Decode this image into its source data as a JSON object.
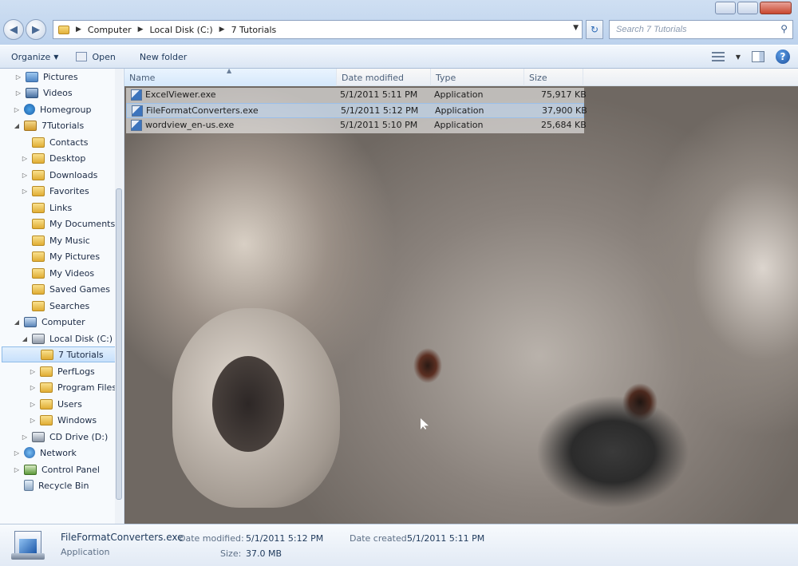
{
  "address": {
    "crumbs": [
      "Computer",
      "Local Disk (C:)",
      "7 Tutorials"
    ]
  },
  "search": {
    "placeholder": "Search 7 Tutorials"
  },
  "toolbar": {
    "organize": "Organize",
    "open": "Open",
    "new_folder": "New folder"
  },
  "navpane": {
    "items": [
      {
        "label": "Pictures"
      },
      {
        "label": "Videos"
      },
      {
        "label": "Homegroup"
      },
      {
        "label": "7Tutorials"
      },
      {
        "label": "Contacts"
      },
      {
        "label": "Desktop"
      },
      {
        "label": "Downloads"
      },
      {
        "label": "Favorites"
      },
      {
        "label": "Links"
      },
      {
        "label": "My Documents"
      },
      {
        "label": "My Music"
      },
      {
        "label": "My Pictures"
      },
      {
        "label": "My Videos"
      },
      {
        "label": "Saved Games"
      },
      {
        "label": "Searches"
      },
      {
        "label": "Computer"
      },
      {
        "label": "Local Disk (C:)"
      },
      {
        "label": "7 Tutorials"
      },
      {
        "label": "PerfLogs"
      },
      {
        "label": "Program Files"
      },
      {
        "label": "Users"
      },
      {
        "label": "Windows"
      },
      {
        "label": "CD Drive (D:)"
      },
      {
        "label": "Network"
      },
      {
        "label": "Control Panel"
      },
      {
        "label": "Recycle Bin"
      }
    ]
  },
  "columns": {
    "name": "Name",
    "date": "Date modified",
    "type": "Type",
    "size": "Size"
  },
  "files": [
    {
      "name": "ExcelViewer.exe",
      "date": "5/1/2011 5:11 PM",
      "type": "Application",
      "size": "75,917 KB"
    },
    {
      "name": "FileFormatConverters.exe",
      "date": "5/1/2011 5:12 PM",
      "type": "Application",
      "size": "37,900 KB"
    },
    {
      "name": "wordview_en-us.exe",
      "date": "5/1/2011 5:10 PM",
      "type": "Application",
      "size": "25,684 KB"
    }
  ],
  "details": {
    "name": "FileFormatConverters.exe",
    "type": "Application",
    "date_modified_label": "Date modified:",
    "date_modified": "5/1/2011 5:12 PM",
    "date_created_label": "Date created:",
    "date_created": "5/1/2011 5:11 PM",
    "size_label": "Size:",
    "size": "37.0 MB"
  },
  "icons": {
    "back": "back-arrow-icon",
    "forward": "forward-arrow-icon",
    "search": "search-icon",
    "refresh": "refresh-icon",
    "help": "help-icon"
  }
}
